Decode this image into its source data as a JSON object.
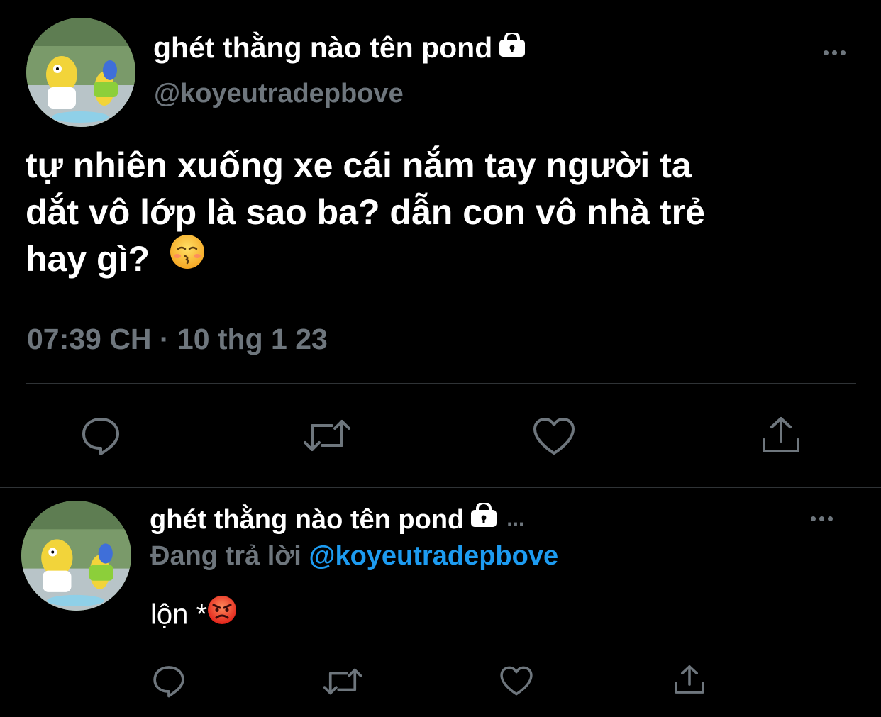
{
  "tweet": {
    "author_name": "ghét thằng nào tên pond",
    "author_handle": "@koyeutradepbove",
    "text_line1": "tự nhiên xuống xe cái nắm tay người ta",
    "text_line2": "dắt vô lớp là sao ba? dẫn con vô nhà trẻ",
    "text_line3": "hay gì?",
    "emoji": "kissing-face-closed-eyes",
    "timestamp": "07:39 CH · 10 thg 1 23",
    "actions": [
      "reply-icon",
      "retweet-icon",
      "like-icon",
      "share-icon"
    ]
  },
  "reply": {
    "author_name": "ghét thằng nào tên pond",
    "truncation": "...",
    "replying_prefix": "Đang trả lời",
    "replying_handle": "@koyeutradepbove",
    "text": "lộn *",
    "emoji": "angry-face",
    "actions": [
      "reply-icon",
      "retweet-icon",
      "like-icon",
      "share-icon"
    ]
  },
  "colors": {
    "background": "#000000",
    "text": "#ffffff",
    "muted": "#6e767d",
    "accent": "#1d9bf0",
    "divider": "#2f3336"
  }
}
